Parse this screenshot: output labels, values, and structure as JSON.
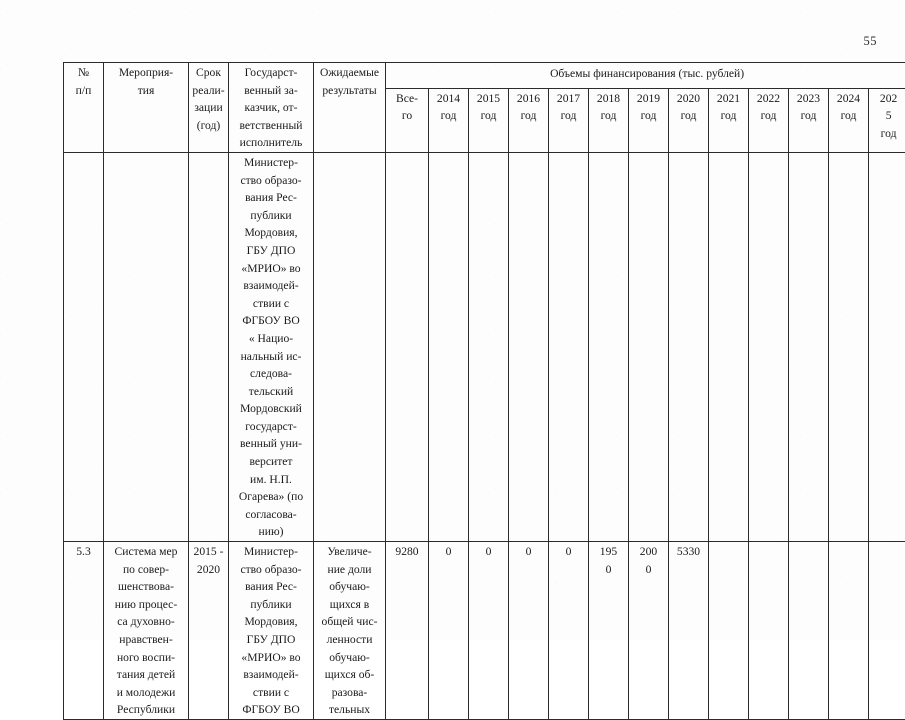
{
  "document": {
    "page_number": "55"
  },
  "table": {
    "header": {
      "col_number": "№ п/п",
      "col_number_l1": "№",
      "col_number_l2": "п/п",
      "col_event": "Мероприя-\nтия",
      "col_event_l1": "Мероприя-",
      "col_event_l2": "тия",
      "col_term": "Срок реали-зации (год)",
      "col_term_l1": "Срок",
      "col_term_l2": "реали-",
      "col_term_l3": "зации",
      "col_term_l4": "(год)",
      "col_customer": "Государст-венный за-казчик, от-ветственный исполнитель",
      "col_customer_l1": "Государст-",
      "col_customer_l2": "венный за-",
      "col_customer_l3": "казчик, от-",
      "col_customer_l4": "ветственный",
      "col_customer_l5": "исполнитель",
      "col_results": "Ожидаемые результаты",
      "col_results_l1": "Ожидаемые",
      "col_results_l2": "результаты",
      "col_financing_group": "Объемы финансирования (тыс. рублей)",
      "col_total_l1": "Все-",
      "col_total_l2": "го",
      "years": [
        {
          "l1": "2014",
          "l2": "год"
        },
        {
          "l1": "2015",
          "l2": "год"
        },
        {
          "l1": "2016",
          "l2": "год"
        },
        {
          "l1": "2017",
          "l2": "год"
        },
        {
          "l1": "2018",
          "l2": "год"
        },
        {
          "l1": "2019",
          "l2": "год"
        },
        {
          "l1": "2020",
          "l2": "год"
        },
        {
          "l1": "2021",
          "l2": "год"
        },
        {
          "l1": "2022",
          "l2": "год"
        },
        {
          "l1": "2023",
          "l2": "год"
        },
        {
          "l1": "2024",
          "l2": "год"
        },
        {
          "l1": "202",
          "l2": "5",
          "l3": "год"
        }
      ]
    },
    "rows": [
      {
        "number": "",
        "event": "",
        "term": "",
        "customer": "Министер-\nство образо-\nвания Рес-\nпублики\nМордовия,\nГБУ ДПО\n«МРИО» во\nвзаимодей-\nствии с\nФГБОУ ВО\n« Нацио-\nнальный ис-\nследова-\nтельский\nМордовский\nгосударст-\nвенный уни-\nверситет\nим. Н.П.\nОгарева» (по\nсогласова-\nнию)",
        "results": "",
        "total": "",
        "values": [
          "",
          "",
          "",
          "",
          "",
          "",
          "",
          "",
          "",
          "",
          "",
          ""
        ]
      },
      {
        "number": "5.3",
        "event": "Система мер\nпо совер-\nшенствова-\nнию процес-\nса духовно-\nнравствен-\nного воспи-\nтания детей\nи молодежи\nРеспублики",
        "term": "2015 -\n2020",
        "customer": "Министер-\nство образо-\nвания Рес-\nпублики\nМордовия,\nГБУ ДПО\n«МРИО» во\nвзаимодей-\nствии с\nФГБОУ ВО",
        "results": "Увеличе-\nние доли\nобучаю-\nщихся в\nобщей чис-\nленности\nобучаю-\nщихся об-\nразова-\nтельных",
        "total": "9280",
        "values": [
          "0",
          "0",
          "0",
          "0",
          "195\n0",
          "200\n0",
          "5330",
          "",
          "",
          "",
          "",
          ""
        ]
      }
    ]
  }
}
